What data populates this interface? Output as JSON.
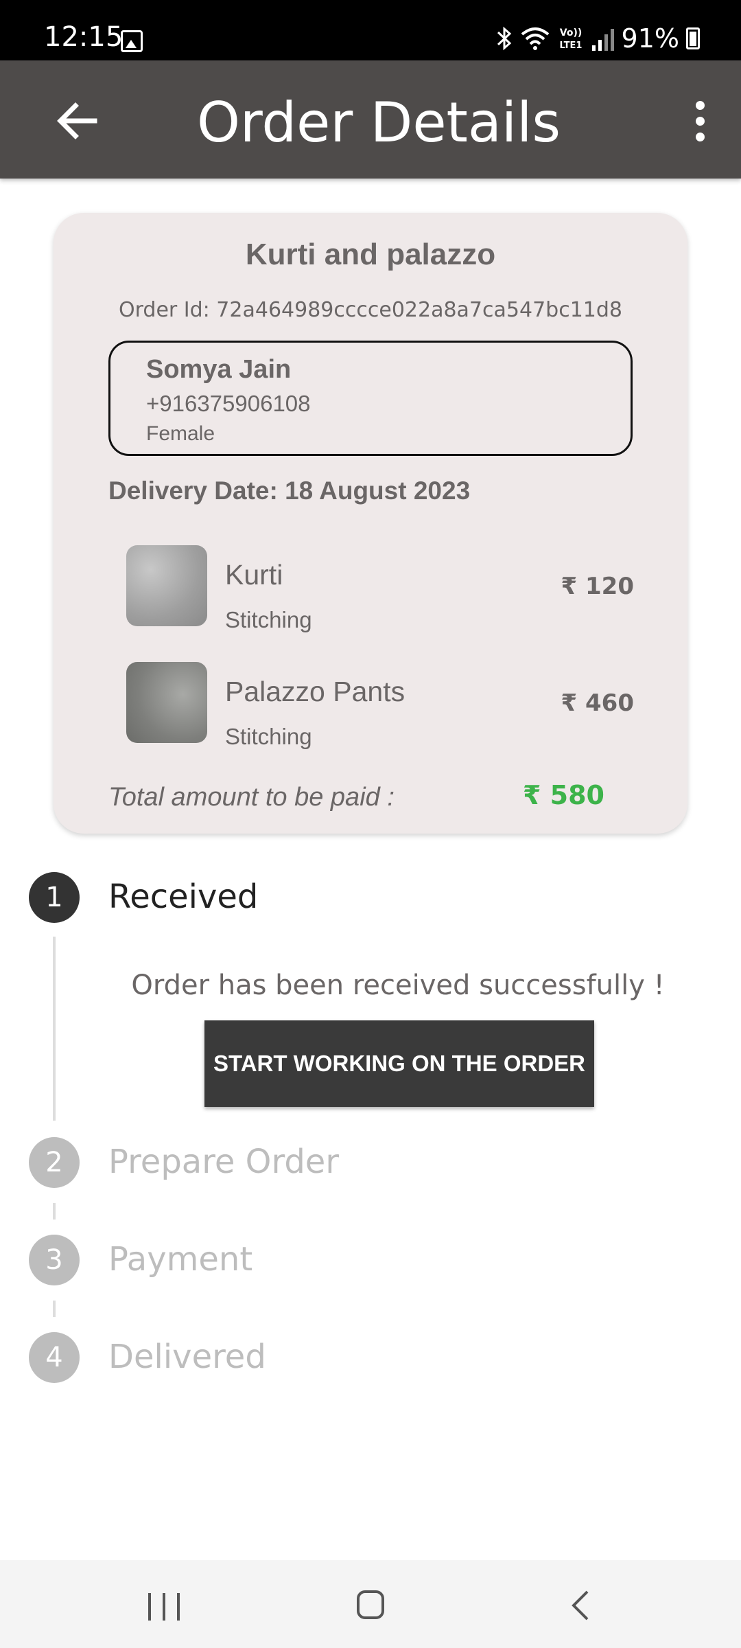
{
  "status_bar": {
    "time": "12:15",
    "battery": "91%",
    "icons": [
      "image-icon",
      "bluetooth-icon",
      "wifi-icon",
      "volte-icon",
      "signal-icon",
      "battery-icon"
    ]
  },
  "app_bar": {
    "title": "Order Details",
    "back_icon": "arrow-left-icon",
    "menu_icon": "more-vertical-icon"
  },
  "order": {
    "title": "Kurti and palazzo",
    "order_id": "Order Id: 72a464989cccce022a8a7ca547bc11d8",
    "customer": {
      "name": "Somya Jain",
      "phone": "+916375906108",
      "gender": "Female"
    },
    "delivery_date": "Delivery Date: 18 August 2023",
    "items": [
      {
        "name": "Kurti",
        "type": "Stitching",
        "price": "₹ 120"
      },
      {
        "name": "Palazzo Pants",
        "type": "Stitching",
        "price": "₹ 460"
      }
    ],
    "total_label": "Total amount to be paid :",
    "total_value": "₹ 580",
    "total_color": "#3db34a"
  },
  "stepper": {
    "steps": [
      {
        "number": "1",
        "label": "Received",
        "state": "active"
      },
      {
        "number": "2",
        "label": "Prepare Order",
        "state": "inactive"
      },
      {
        "number": "3",
        "label": "Payment",
        "state": "inactive"
      },
      {
        "number": "4",
        "label": "Delivered",
        "state": "inactive"
      }
    ],
    "message": "Order has been received successfully !",
    "button_label": "START WORKING ON THE ORDER"
  },
  "nav_bar": {
    "icons": [
      "recents-icon",
      "home-icon",
      "back-icon"
    ]
  }
}
